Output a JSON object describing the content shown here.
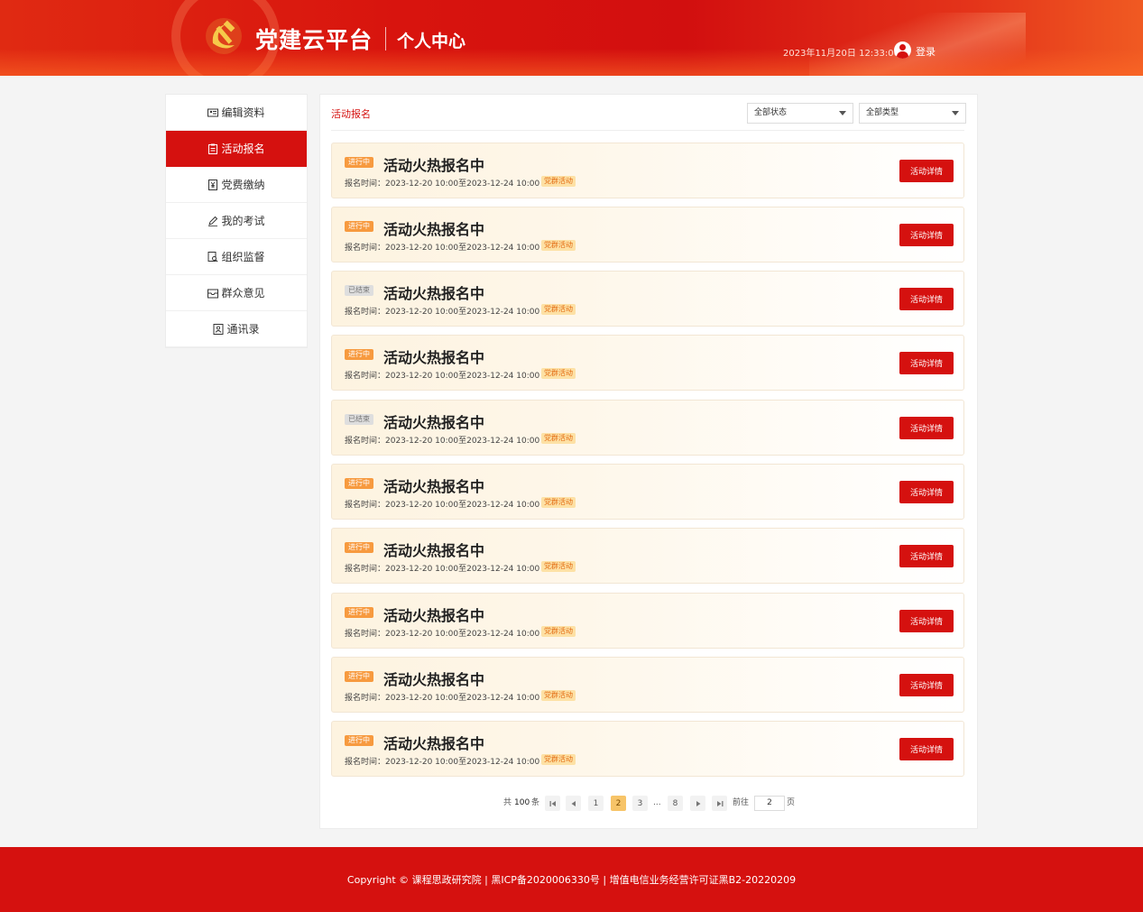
{
  "header": {
    "brand": "党建云平台",
    "subtitle": "个人中心",
    "datetime": "2023年11月20日 12:33:00",
    "login_label": "登录",
    "brand_color": "#d5110f"
  },
  "sidebar": {
    "items": [
      {
        "label": "编辑资料",
        "icon": "id-card-icon"
      },
      {
        "label": "活动报名",
        "icon": "clipboard-icon",
        "active": true
      },
      {
        "label": "党费缴纳",
        "icon": "yuan-receipt-icon"
      },
      {
        "label": "我的考试",
        "icon": "pen-icon"
      },
      {
        "label": "组织监督",
        "icon": "magnifier-doc-icon"
      },
      {
        "label": "群众意见",
        "icon": "inbox-icon"
      },
      {
        "label": "通讯录",
        "icon": "contacts-icon"
      }
    ]
  },
  "main": {
    "title": "活动报名",
    "filters": {
      "status": "全部状态",
      "type": "全部类型"
    },
    "cards": [
      {
        "badge": "进行中",
        "status": "on",
        "title": "活动火热报名中",
        "time": "报名时间：2023-12-20 10:00至2023-12-24 10:00",
        "tag": "党群活动",
        "button": "活动详情"
      },
      {
        "badge": "进行中",
        "status": "on",
        "title": "活动火热报名中",
        "time": "报名时间：2023-12-20 10:00至2023-12-24 10:00",
        "tag": "党群活动",
        "button": "活动详情"
      },
      {
        "badge": "已结束",
        "status": "off",
        "title": "活动火热报名中",
        "time": "报名时间：2023-12-20 10:00至2023-12-24 10:00",
        "tag": "党群活动",
        "button": "活动详情"
      },
      {
        "badge": "进行中",
        "status": "on",
        "title": "活动火热报名中",
        "time": "报名时间：2023-12-20 10:00至2023-12-24 10:00",
        "tag": "党群活动",
        "button": "活动详情"
      },
      {
        "badge": "已结束",
        "status": "off",
        "title": "活动火热报名中",
        "time": "报名时间：2023-12-20 10:00至2023-12-24 10:00",
        "tag": "党群活动",
        "button": "活动详情"
      },
      {
        "badge": "进行中",
        "status": "on",
        "title": "活动火热报名中",
        "time": "报名时间：2023-12-20 10:00至2023-12-24 10:00",
        "tag": "党群活动",
        "button": "活动详情"
      },
      {
        "badge": "进行中",
        "status": "on",
        "title": "活动火热报名中",
        "time": "报名时间：2023-12-20 10:00至2023-12-24 10:00",
        "tag": "党群活动",
        "button": "活动详情"
      },
      {
        "badge": "进行中",
        "status": "on",
        "title": "活动火热报名中",
        "time": "报名时间：2023-12-20 10:00至2023-12-24 10:00",
        "tag": "党群活动",
        "button": "活动详情"
      },
      {
        "badge": "进行中",
        "status": "on",
        "title": "活动火热报名中",
        "time": "报名时间：2023-12-20 10:00至2023-12-24 10:00",
        "tag": "党群活动",
        "button": "活动详情"
      },
      {
        "badge": "进行中",
        "status": "on",
        "title": "活动火热报名中",
        "time": "报名时间：2023-12-20 10:00至2023-12-24 10:00",
        "tag": "党群活动",
        "button": "活动详情"
      }
    ],
    "pagination": {
      "total_prefix": "共",
      "total": "100",
      "total_suffix": "条",
      "pages": [
        "1",
        "2",
        "3",
        "...",
        "8"
      ],
      "current": "2",
      "goto_label": "前往",
      "goto_value": "2",
      "page_unit": "页"
    }
  },
  "footer": {
    "copyright": "Copyright © 课程思政研究院 | 黑ICP备2020006330号 | 增值电信业务经营许可证黑B2-20220209"
  }
}
